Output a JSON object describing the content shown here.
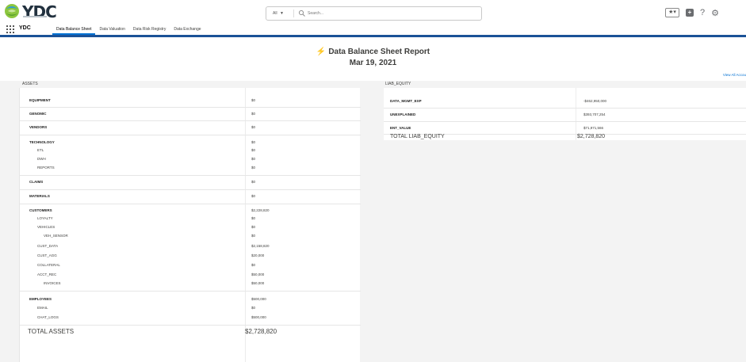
{
  "header": {
    "logo_text": "YDC",
    "search_scope": "All",
    "search_placeholder": "Search..."
  },
  "nav": {
    "app_name": "YDC",
    "tabs": [
      {
        "label": "Data Balance Sheet",
        "active": true
      },
      {
        "label": "Data Valuation",
        "active": false
      },
      {
        "label": "Data Risk Registry",
        "active": false
      },
      {
        "label": "Data Exchange",
        "active": false
      }
    ]
  },
  "report": {
    "title": "Data Balance Sheet Report",
    "date": "Mar 19, 2021",
    "view_all": "View All Accou",
    "assets_label": "ASSETS",
    "liab_label": "LIAB_EQUITY",
    "assets": {
      "equipment": {
        "name": "EQUIPMENT",
        "value": "$0"
      },
      "genomic": {
        "name": "GENOMIC",
        "value": "$0"
      },
      "vendors": {
        "name": "VENDORS",
        "value": "$0"
      },
      "technology": {
        "name": "TECHNOLOGY",
        "value": "$0"
      },
      "etl": {
        "name": "ETL",
        "value": "$0"
      },
      "dwh": {
        "name": "DWH",
        "value": "$0"
      },
      "reports": {
        "name": "REPORTS",
        "value": "$0"
      },
      "claims": {
        "name": "CLAIMS",
        "value": "$0"
      },
      "materials": {
        "name": "MATERIALS",
        "value": "$0"
      },
      "customers": {
        "name": "CUSTOMERS",
        "value": "$2,228,820"
      },
      "loyalty": {
        "name": "LOYALTY",
        "value": "$0"
      },
      "vehicles": {
        "name": "VEHICLES",
        "value": "$0"
      },
      "veh_sensor": {
        "name": "VEH_SENSOR",
        "value": "$0"
      },
      "cust_data": {
        "name": "CUST_DATA",
        "value": "$2,158,820"
      },
      "cust_agg": {
        "name": "CUST_AGG",
        "value": "$20,000"
      },
      "collateral": {
        "name": "COLLATERAL",
        "value": "$0"
      },
      "acct_rec": {
        "name": "ACCT_REC",
        "value": "$50,000"
      },
      "invoices": {
        "name": "INVOICES",
        "value": "$50,000"
      },
      "employees": {
        "name": "EMPLOYEES",
        "value": "$500,000"
      },
      "email": {
        "name": "EMAIL",
        "value": "$0"
      },
      "chat_logs": {
        "name": "CHAT_LOGS",
        "value": "$500,000"
      },
      "total": {
        "name": "TOTAL ASSETS",
        "value": "$2,728,820"
      }
    },
    "liabilities": {
      "data_mgmt_exp": {
        "name": "DATA_MGMT_EXP",
        "value": "-$462,950,000"
      },
      "unexplained": {
        "name": "UNEXPLAINED",
        "value": "$393,707,254"
      },
      "ent_value": {
        "name": "ENT_VALUE",
        "value": "$71,971,566"
      },
      "total": {
        "name": "TOTAL LIAB_EQUITY",
        "value": "$2,728,820"
      }
    }
  }
}
